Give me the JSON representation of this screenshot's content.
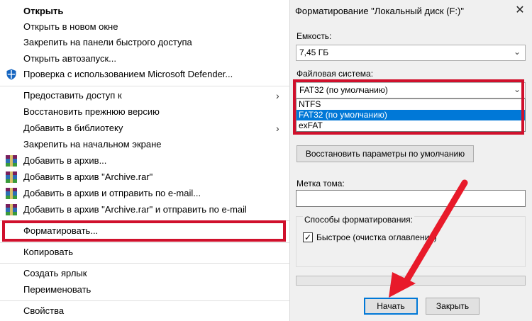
{
  "context_menu": {
    "items": [
      {
        "label": "Открыть",
        "bold": true,
        "icon": ""
      },
      {
        "label": "Открыть в новом окне",
        "icon": ""
      },
      {
        "label": "Закрепить на панели быстрого доступа",
        "icon": ""
      },
      {
        "label": "Открыть автозапуск...",
        "icon": ""
      },
      {
        "label": "Проверка с использованием Microsoft Defender...",
        "icon": "defender-shield-icon"
      },
      {
        "label": "Предоставить доступ к",
        "icon": "",
        "submenu": true
      },
      {
        "label": "Восстановить прежнюю версию",
        "icon": ""
      },
      {
        "label": "Добавить в библиотеку",
        "icon": "",
        "submenu": true
      },
      {
        "label": "Закрепить на начальном экране",
        "icon": ""
      },
      {
        "label": "Добавить в архив...",
        "icon": "winrar-icon"
      },
      {
        "label": "Добавить в архив \"Archive.rar\"",
        "icon": "winrar-icon"
      },
      {
        "label": "Добавить в архив и отправить по e-mail...",
        "icon": "winrar-icon"
      },
      {
        "label": "Добавить в архив \"Archive.rar\" и отправить по e-mail",
        "icon": "winrar-icon"
      },
      {
        "label": "Форматировать...",
        "icon": "",
        "highlighted": true
      },
      {
        "label": "Копировать",
        "icon": ""
      },
      {
        "label": "Создать ярлык",
        "icon": ""
      },
      {
        "label": "Переименовать",
        "icon": ""
      },
      {
        "label": "Свойства",
        "icon": ""
      }
    ],
    "submenu_arrow": "›"
  },
  "format_dialog": {
    "title": "Форматирование \"Локальный диск (F:)\"",
    "close_glyph": "✕",
    "capacity_label": "Емкость:",
    "capacity_value": "7,45 ГБ",
    "filesystem_label": "Файловая система:",
    "filesystem_value": "FAT32 (по умолчанию)",
    "filesystem_options": [
      "NTFS",
      "FAT32 (по умолчанию)",
      "exFAT"
    ],
    "filesystem_selected_index": 1,
    "restore_defaults_button": "Восстановить параметры по умолчанию",
    "volume_label_label": "Метка тома:",
    "volume_label_value": "",
    "format_options_label": "Способы форматирования:",
    "quick_format_label": "Быстрое (очистка оглавления)",
    "quick_format_checked": true,
    "progress": 0,
    "start_button": "Начать",
    "close_button": "Закрыть",
    "chevron_glyph": "⌄",
    "check_glyph": "✓"
  },
  "colors": {
    "highlight_red": "#d0102c",
    "selection_blue": "#0078d7",
    "dialog_bg": "#f0f0f0"
  }
}
